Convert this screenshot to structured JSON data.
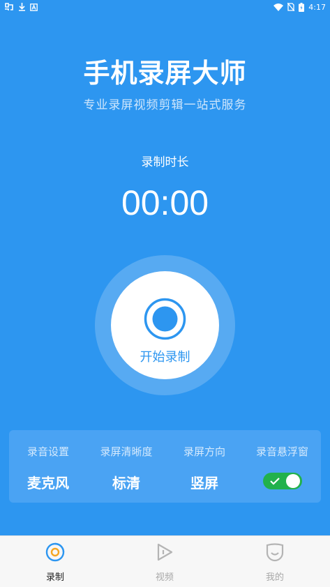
{
  "status_bar": {
    "time": "4:17",
    "left_icons": [
      "app-notification-icon",
      "download-icon",
      "a-notification-icon"
    ],
    "right_icons": [
      "wifi-icon",
      "no-sim-icon",
      "battery-icon"
    ]
  },
  "header": {
    "title": "手机录屏大师",
    "subtitle": "专业录屏视频剪辑一站式服务"
  },
  "recording": {
    "duration_label": "录制时长",
    "timer": "00:00",
    "start_button_label": "开始录制"
  },
  "settings": [
    {
      "title": "录音设置",
      "value": "麦克风"
    },
    {
      "title": "录屏清晰度",
      "value": "标清"
    },
    {
      "title": "录屏方向",
      "value": "竖屏"
    },
    {
      "title": "录音悬浮窗",
      "toggle_on": true
    }
  ],
  "bottom_nav": {
    "items": [
      {
        "label": "录制",
        "icon": "record-tab-icon",
        "active": true
      },
      {
        "label": "视频",
        "icon": "video-tab-icon",
        "active": false
      },
      {
        "label": "我的",
        "icon": "profile-tab-icon",
        "active": false
      }
    ]
  },
  "colors": {
    "background": "#2d96f0",
    "toggle_on": "#22b14c",
    "record_accent": "#f5a623"
  }
}
